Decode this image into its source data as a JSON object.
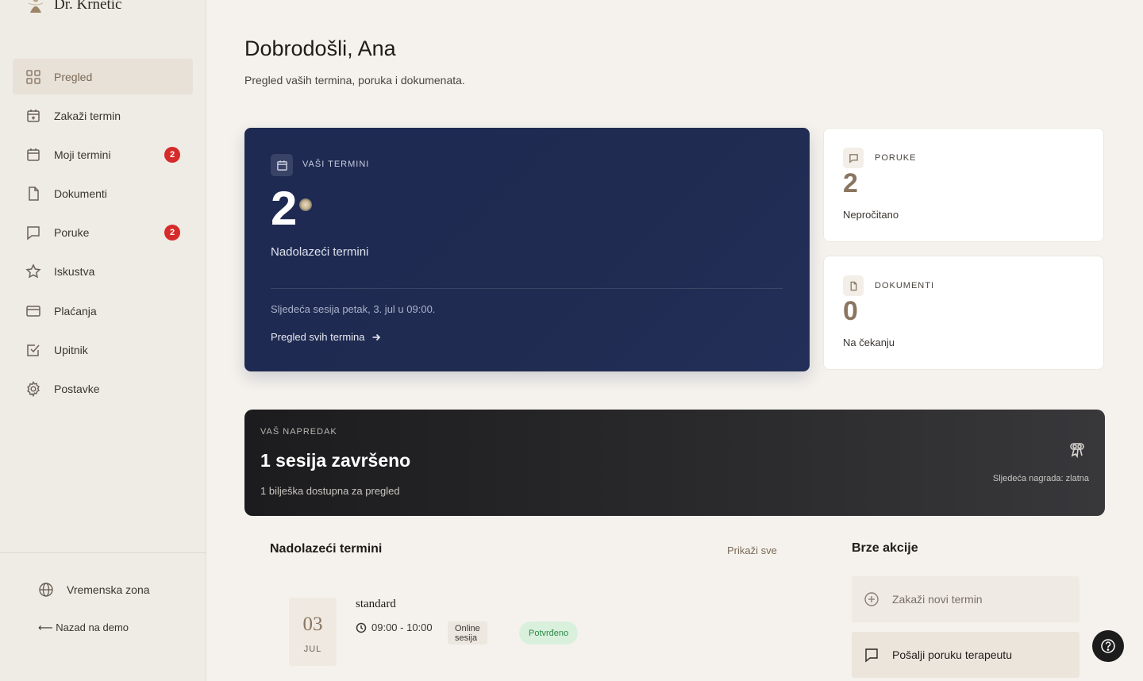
{
  "brand": {
    "name": "Dr. Krnetić",
    "logo_icon": "figure-logo-icon"
  },
  "sidebar": {
    "items": [
      {
        "label": "Pregled",
        "icon": "grid-icon",
        "active": true
      },
      {
        "label": "Zakaži termin",
        "icon": "calendar-plus-icon"
      },
      {
        "label": "Moji termini",
        "icon": "calendar-icon",
        "badge": "2"
      },
      {
        "label": "Dokumenti",
        "icon": "file-icon"
      },
      {
        "label": "Poruke",
        "icon": "message-icon",
        "badge": "2"
      },
      {
        "label": "Iskustva",
        "icon": "star-icon"
      },
      {
        "label": "Plaćanja",
        "icon": "credit-card-icon"
      },
      {
        "label": "Upitnik",
        "icon": "checkbox-icon"
      },
      {
        "label": "Postavke",
        "icon": "gear-icon"
      }
    ],
    "timezone_label": "Vremenska zona",
    "back_label": "⟵ Nazad na demo"
  },
  "header": {
    "title": "Dobrodošli, Ana",
    "subtitle": "Pregled vaših termina, poruka i dokumenata."
  },
  "terms_card": {
    "label": "VAŠI TERMINI",
    "count": "2",
    "caption": "Nadolazeći termini",
    "next_session": "Sljedeća sesija petak, 3. jul u 09:00.",
    "link": "Pregled svih termina"
  },
  "messages_card": {
    "label": "PORUKE",
    "count": "2",
    "caption": "Nepročitano"
  },
  "documents_card": {
    "label": "DOKUMENTI",
    "count": "0",
    "caption": "Na čekanju"
  },
  "progress": {
    "label": "VAŠ NAPREDAK",
    "title": "1 sesija završeno",
    "subtitle": "1 bilješka dostupna za pregled",
    "next_reward": "Sljedeća nagrada: zlatna"
  },
  "upcoming": {
    "title": "Nadolazeći termini",
    "show_all": "Prikaži sve",
    "items": [
      {
        "day": "03",
        "month": "JUL",
        "type": "standard",
        "time": "09:00 - 10:00",
        "mode": "Online sesija",
        "status": "Potvrđeno"
      }
    ]
  },
  "quick_actions": {
    "title": "Brze akcije",
    "items": [
      {
        "label": "Zakaži novi termin",
        "icon": "plus-circle-icon"
      },
      {
        "label": "Pošalji poruku terapeutu",
        "icon": "message-icon"
      }
    ]
  },
  "colors": {
    "navy": "#1e2a52",
    "accent": "#8a7560",
    "badge": "#d52b2b",
    "success": "#2c8a44"
  }
}
